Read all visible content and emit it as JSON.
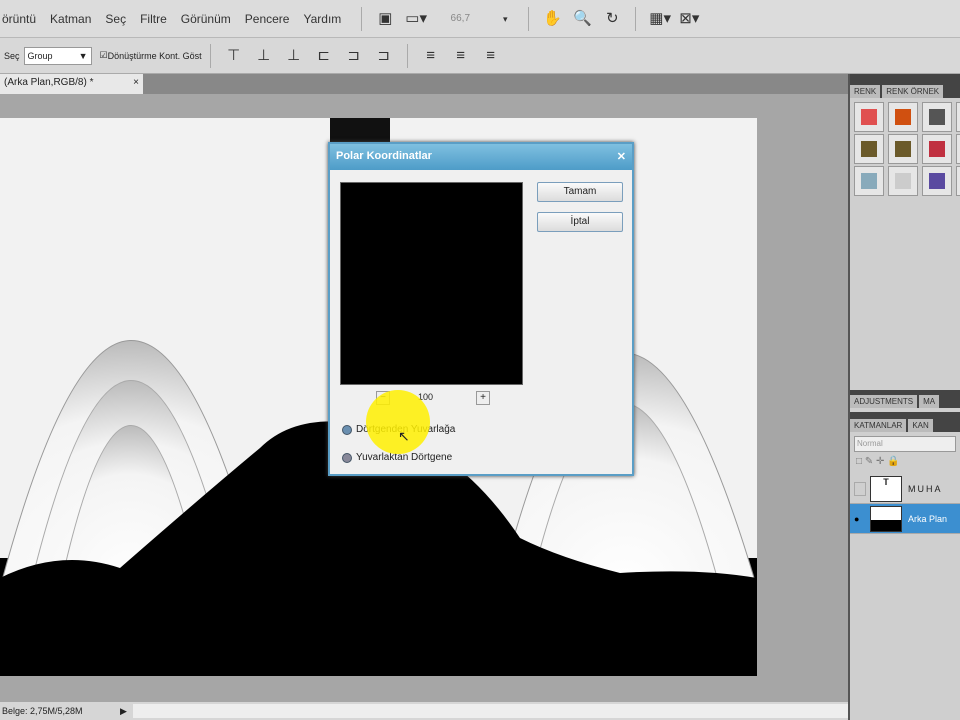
{
  "menu": [
    "örüntü",
    "Katman",
    "Seç",
    "Filtre",
    "Görünüm",
    "Pencere",
    "Yardım"
  ],
  "zoom_level": "66,7",
  "options": {
    "auto_select_label": "Seç",
    "auto_select_value": "Group",
    "transform_checkbox": "Dönüştürme Kont. Göst"
  },
  "doc_tab": {
    "title": "(Arka Plan,RGB/8) *",
    "close": "×"
  },
  "status": {
    "doc_size": "Belge: 2,75M/5,28M"
  },
  "panel": {
    "tabs": [
      "RENK",
      "RENK ÖRNEK"
    ],
    "adjustments_tabs": [
      "ADJUSTMENTS",
      "MA"
    ],
    "layers_tabs": [
      "KATMANLAR",
      "KAN"
    ],
    "blend_mode": "Normal",
    "layers": [
      {
        "name": "MUHA",
        "visible": false
      },
      {
        "name": "Arka Plan",
        "visible": true,
        "selected": true
      }
    ]
  },
  "swatch_colors": [
    "#e05050",
    "#d05010",
    "#555555",
    "#222222",
    "#6b5a2a",
    "#6b5a2a",
    "#c03040",
    "#208080",
    "#8ab",
    "#ccc",
    "#5a4aa0",
    "#555"
  ],
  "dialog": {
    "title": "Polar Koordinatlar",
    "ok": "Tamam",
    "cancel": "İptal",
    "zoom_minus": "−",
    "zoom_plus": "+",
    "zoom_value": "100",
    "options": [
      {
        "label": "Dörtgenden Yuvarlağa",
        "checked": true
      },
      {
        "label": "Yuvarlaktan Dörtgene",
        "checked": false
      }
    ],
    "close": "✕"
  }
}
